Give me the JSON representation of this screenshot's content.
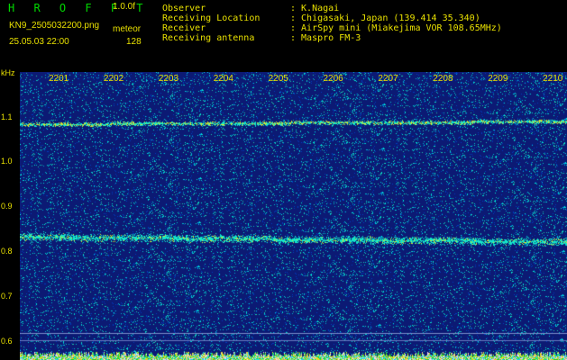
{
  "header": {
    "logo": "H R O F F T",
    "version": "1.0.0f",
    "filename": "KN9_2505032200.png",
    "mode": "meteor",
    "datetime": "25.05.03 22:00",
    "count": "128"
  },
  "meta": {
    "observer_label": "Observer",
    "observer_value": ": K.Nagai",
    "location_label": "Receiving Location",
    "location_value": ": Chigasaki, Japan (139.414 35.340)",
    "receiver_label": "Receiver",
    "receiver_value": ": AirSpy mini (Miakejima VOR 108.65MHz)",
    "antenna_label": "Receiving antenna",
    "antenna_value": ": Maspro FM-3"
  },
  "axis": {
    "y_unit": "kHz",
    "y_ticks": [
      "1.1",
      "1.0",
      "0.9",
      "0.8",
      "0.7",
      "0.6"
    ],
    "x_ticks": [
      "2201",
      "2202",
      "2203",
      "2204",
      "2205",
      "2206",
      "2207",
      "2208",
      "2209",
      "2210"
    ]
  },
  "colors": {
    "background": "#0b1a72",
    "text": "#e8e000",
    "logo": "#00d800"
  }
}
